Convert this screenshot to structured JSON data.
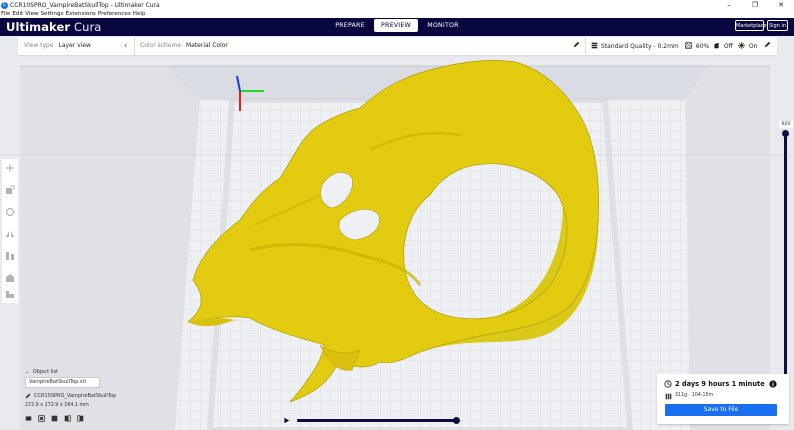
{
  "window": {
    "title": "CCR10SPRO_VampireBatSkullTop - Ultimaker Cura",
    "controls": [
      "–",
      "❐",
      "✕"
    ]
  },
  "menu": [
    "File",
    "Edit",
    "View",
    "Settings",
    "Extensions",
    "Preferences",
    "Help"
  ],
  "header": {
    "brand_bold": "Ultimaker",
    "brand_light": "Cura",
    "stages": [
      "PREPARE",
      "PREVIEW",
      "MONITOR"
    ],
    "active_stage": "PREVIEW",
    "marketplace_label": "Marketplace",
    "signin_label": "Sign in"
  },
  "toolbar": {
    "view_type_label": "View type",
    "view_type_value": "Layer view",
    "color_scheme_label": "Color scheme",
    "color_scheme_value": "Material Color",
    "quality": "Standard Quality - 0.2mm",
    "infill": "60%",
    "support": "Off",
    "adhesion": "On"
  },
  "layer_slider": {
    "current_layer": "920"
  },
  "object_list": {
    "toggle_label": "Object list",
    "file_name": "VampireBatSkullTop.stl",
    "machine_name": "CCR10SPRO_VampireBatSkullTop",
    "dimensions": "272.9 x 272.9 x 184.1 mm"
  },
  "print_info": {
    "time": "2 days 9 hours 1 minute",
    "material": "311g · 104.15m",
    "save_label": "Save to File"
  },
  "colors": {
    "header_bg": "#08073f",
    "accent": "#196ef0",
    "model_yellow": "#e8d010",
    "slider": "#0f0c44"
  },
  "icons": [
    "app-icon",
    "chevron-left-icon",
    "pencil-icon",
    "quality-icon",
    "infill-icon",
    "support-icon",
    "adhesion-icon",
    "move-icon",
    "scale-icon",
    "rotate-icon",
    "mirror-icon",
    "per-model-settings-icon",
    "support-blocker-icon",
    "clock-icon",
    "info-icon",
    "spool-icon",
    "play-icon"
  ]
}
